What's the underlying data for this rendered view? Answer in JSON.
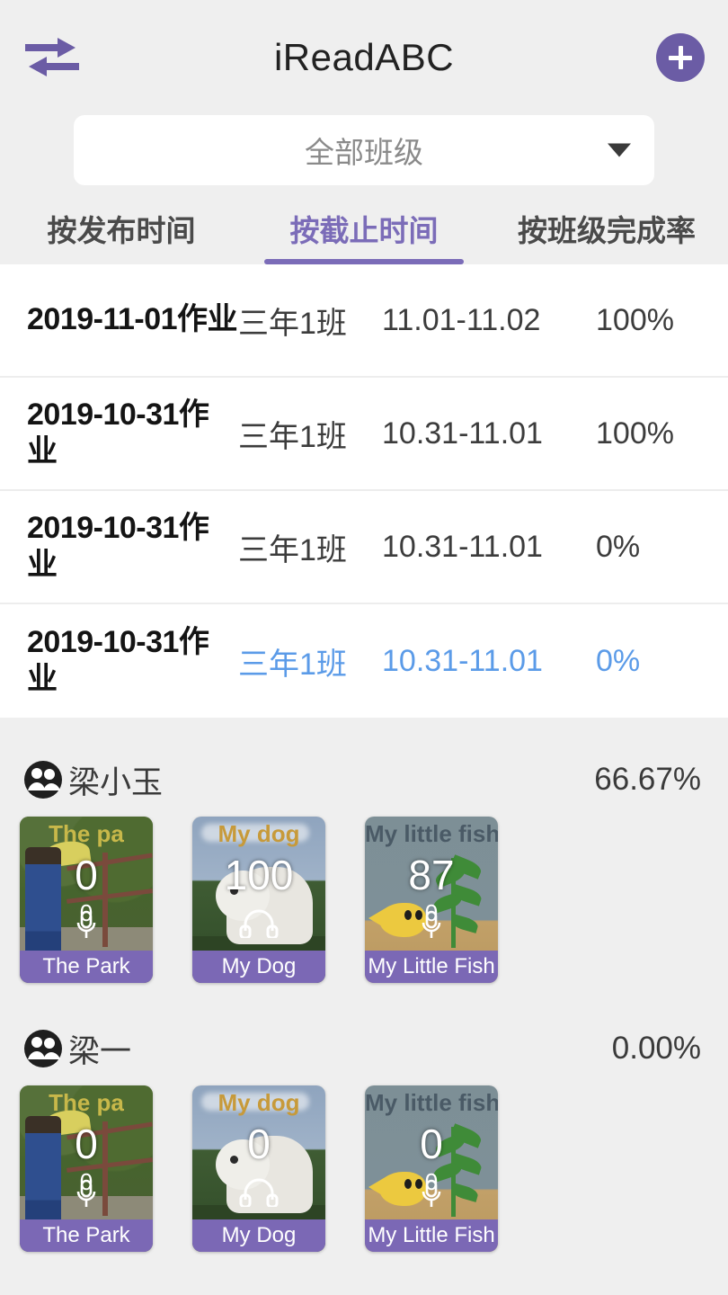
{
  "header": {
    "title": "iReadABC",
    "swap_icon": "swap-arrows-icon",
    "add_icon": "plus-icon",
    "accent_purple": "#6b5ca5"
  },
  "class_select": {
    "value": "全部班级",
    "caret_icon": "caret-down-icon"
  },
  "tabs": [
    {
      "label": "按发布时间",
      "active": false
    },
    {
      "label": "按截止时间",
      "active": true
    },
    {
      "label": "按班级完成率",
      "active": false
    }
  ],
  "tab_active_color": "#7b6cb8",
  "selected_row_color": "#5b9be8",
  "assignments": [
    {
      "title": "2019-11-01作业",
      "class": "三年1班",
      "range": "11.01-11.02",
      "pct": "100%",
      "selected": false
    },
    {
      "title": "2019-10-31作业",
      "class": "三年1班",
      "range": "10.31-11.01",
      "pct": "100%",
      "selected": false
    },
    {
      "title": "2019-10-31作业",
      "class": "三年1班",
      "range": "10.31-11.01",
      "pct": "0%",
      "selected": false
    },
    {
      "title": "2019-10-31作业",
      "class": "三年1班",
      "range": "10.31-11.01",
      "pct": "0%",
      "selected": true
    }
  ],
  "students": [
    {
      "avatar_icon": "group-people-icon",
      "name": "梁小玉",
      "pct": "66.67%",
      "cards": [
        {
          "scene": "park",
          "header_text": "The  pa",
          "header_color": "#c8b84a",
          "score": "0",
          "media_icon": "microphone-icon",
          "media_value": "0",
          "label": "The Park"
        },
        {
          "scene": "dog",
          "header_text": "My  dog",
          "header_color": "#c79a3a",
          "score": "100",
          "media_icon": "headphones-icon",
          "media_value": "",
          "label": "My Dog"
        },
        {
          "scene": "fish",
          "header_text": "My  little  fish",
          "header_color": "#4a5a66",
          "score": "87",
          "media_icon": "microphone-icon",
          "media_value": "0",
          "label": "My Little Fish"
        }
      ]
    },
    {
      "avatar_icon": "group-people-icon",
      "name": "梁一",
      "pct": "0.00%",
      "cards": [
        {
          "scene": "park",
          "header_text": "The  pa",
          "header_color": "#c8b84a",
          "score": "0",
          "media_icon": "microphone-icon",
          "media_value": "0",
          "label": "The Park"
        },
        {
          "scene": "dog",
          "header_text": "My  dog",
          "header_color": "#c79a3a",
          "score": "0",
          "media_icon": "headphones-icon",
          "media_value": "",
          "label": "My Dog"
        },
        {
          "scene": "fish",
          "header_text": "My  little  fish",
          "header_color": "#4a5a66",
          "score": "0",
          "media_icon": "microphone-icon",
          "media_value": "0",
          "label": "My Little Fish"
        }
      ]
    }
  ]
}
